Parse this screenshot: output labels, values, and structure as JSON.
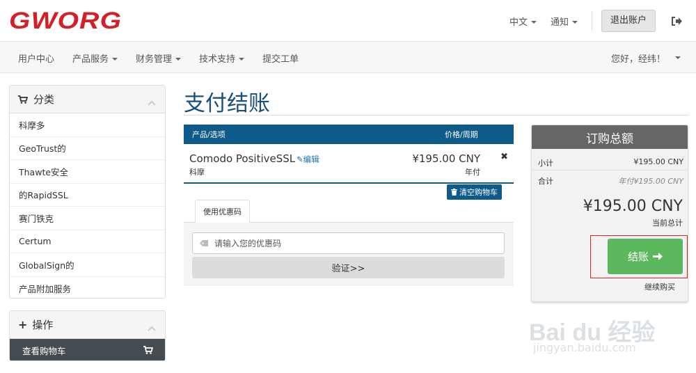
{
  "brand": {
    "logo_text": "GWORG",
    "color": "#d51f26"
  },
  "topbar": {
    "language": "中文",
    "notifications": "通知",
    "logout_label": "退出账户"
  },
  "nav": {
    "items": [
      "用户中心",
      "产品服务",
      "财务管理",
      "技术支持",
      "提交工单"
    ],
    "greeting": "您好，经纬！"
  },
  "sidebar": {
    "categories_title": "分类",
    "categories": [
      "科摩多",
      "GeoTrust的",
      "Thawte安全",
      "的RapidSSL",
      "赛门铁克",
      "Certum",
      "GlobalSign的",
      "产品附加服务"
    ],
    "actions_title": "操作",
    "actions": [
      "查看购物车"
    ]
  },
  "main": {
    "title": "支付结账",
    "cart_header": {
      "product": "产品/选项",
      "price": "价格/周期"
    },
    "item": {
      "name": "Comodo PositiveSSL",
      "edit": "编辑",
      "vendor": "科摩",
      "price": "¥195.00 CNY",
      "cycle": "年付",
      "remove": "✖"
    },
    "empty_cart": "清空购物车",
    "promo": {
      "tab": "使用优惠码",
      "placeholder": "请输入您的优惠码",
      "verify": "验证>>"
    }
  },
  "summary": {
    "title": "订购总额",
    "subtotal_label": "小计",
    "subtotal_value": "¥195.00 CNY",
    "total_label": "合计",
    "total_value": "年付¥195.00 CNY",
    "grand_total": "¥195.00 CNY",
    "grand_total_label": "当前总计",
    "checkout": "结账",
    "continue": "继续购买"
  },
  "watermark": {
    "text": "Bai du 经验",
    "sub": "jingyan.baidu.com"
  },
  "colors": {
    "primary": "#0e5a8a",
    "title": "#1a4f79",
    "success": "#5cb85c"
  }
}
